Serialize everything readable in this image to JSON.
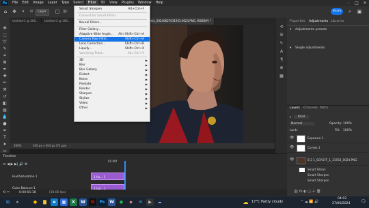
{
  "app": {
    "logo": "Ps"
  },
  "menubar": {
    "items": [
      "File",
      "Edit",
      "Image",
      "Layer",
      "Type",
      "Select",
      "Filter",
      "3D",
      "View",
      "Plugins",
      "Window",
      "Help"
    ],
    "active_index": 6
  },
  "options": {
    "layer_select": "Layer",
    "share_label": "Share"
  },
  "tabs": [
    {
      "label": "Untitled-1 @ 200..."
    },
    {
      "label": "Untitled-2 @ 100..."
    },
    {
      "label": "Untitled-3 ..."
    },
    {
      "label": "..."
    },
    {
      "label": "...1080p.WEB.h264-ELEANOR.mkv_20240627031933.0024.PNG, RGB/8#) *"
    }
  ],
  "filter_menu": {
    "items": [
      {
        "label": "Smart Sharpen",
        "shortcut": "Alt+Ctrl+F",
        "state": "normal"
      },
      {
        "sep": true
      },
      {
        "label": "Convert for Smart Filters",
        "shortcut": "",
        "state": "disabled"
      },
      {
        "sep": true
      },
      {
        "label": "Neural Filters...",
        "shortcut": "",
        "state": "normal"
      },
      {
        "sep": true
      },
      {
        "label": "Filter Gallery...",
        "shortcut": "",
        "state": "normal"
      },
      {
        "label": "Adaptive Wide Angle...",
        "shortcut": "Alt+Shift+Ctrl+A",
        "state": "normal"
      },
      {
        "label": "Camera Raw Filter...",
        "shortcut": "Shift+Ctrl+A",
        "state": "highlight"
      },
      {
        "label": "Lens Correction...",
        "shortcut": "Shift+Ctrl+R",
        "state": "normal"
      },
      {
        "label": "Liquify...",
        "shortcut": "Shift+Ctrl+X",
        "state": "normal"
      },
      {
        "label": "Vanishing Point...",
        "shortcut": "Alt+Ctrl+V",
        "state": "disabled"
      },
      {
        "sep": true
      },
      {
        "label": "3D",
        "submenu": true
      },
      {
        "label": "Blur",
        "submenu": true
      },
      {
        "label": "Blur Gallery",
        "submenu": true
      },
      {
        "label": "Distort",
        "submenu": true
      },
      {
        "label": "Noise",
        "submenu": true
      },
      {
        "label": "Pixelate",
        "submenu": true
      },
      {
        "label": "Render",
        "submenu": true
      },
      {
        "label": "Sharpen",
        "submenu": true
      },
      {
        "label": "Stylize",
        "submenu": true
      },
      {
        "label": "Video",
        "submenu": true
      },
      {
        "label": "Other",
        "submenu": true
      }
    ]
  },
  "status": {
    "zoom": "200%",
    "size": "540 px x 304 px (72 ppi)"
  },
  "panels": {
    "top_tabs": [
      "Properties",
      "Adjustments",
      "Libraries"
    ],
    "adj_presets": "Adjustments presets",
    "single_adj": "Single adjustments",
    "layer_tabs": [
      "Layers",
      "Channels",
      "Paths"
    ],
    "kind": "Kind",
    "blend": "Normal",
    "opacity_label": "Opacity:",
    "opacity": "100%",
    "lock_label": "Lock:",
    "fill_label": "Fill:",
    "fill": "100%",
    "layers": [
      {
        "name": "Exposure 1"
      },
      {
        "name": "Curves 1"
      },
      {
        "name": "B 2 1_0GYGFF_1_31933_0024.PNG"
      },
      {
        "name": "Smart Filters"
      },
      {
        "name": "Smart Sharpen"
      },
      {
        "name": "Smart Sharpen"
      }
    ]
  },
  "timeline": {
    "title": "Timeline",
    "time": "0:00:01:18",
    "fps": "(30.00 fps)",
    "marker": "01:00f",
    "tracks": [
      "Hue/Saturation 1",
      "Color Balance 1"
    ],
    "clips": [
      "1 Hu... 1",
      "1 Col... 1"
    ]
  },
  "taskbar": {
    "weather": "17°C  Partly cloudy",
    "time": "04:02",
    "date": "27/06/2024",
    "icons": [
      {
        "name": "windows-icon",
        "glyph": "⊞",
        "color": "#3aa0ff",
        "bg": "transparent"
      },
      {
        "name": "search-icon",
        "glyph": "⌕",
        "color": "#ddd",
        "bg": "transparent"
      },
      {
        "name": "chrome-icon",
        "glyph": "●",
        "color": "#fbbc05",
        "bg": "transparent"
      },
      {
        "name": "explorer-icon",
        "glyph": "▇",
        "color": "#f4c542",
        "bg": "transparent"
      },
      {
        "name": "edge-icon",
        "glyph": "e",
        "color": "#fff",
        "bg": "#0f7ac6"
      },
      {
        "name": "store-icon",
        "glyph": "▦",
        "color": "#fff",
        "bg": "#2d6ad9"
      },
      {
        "name": "excel-icon",
        "glyph": "X",
        "color": "#fff",
        "bg": "#1d7a45"
      },
      {
        "name": "word-icon",
        "glyph": "W",
        "color": "#fff",
        "bg": "#2b5797"
      },
      {
        "name": "netflix-icon",
        "glyph": "N",
        "color": "#e50914",
        "bg": "#111"
      },
      {
        "name": "photoshop-icon",
        "glyph": "Ps",
        "color": "#31a8ff",
        "bg": "#001e36"
      },
      {
        "name": "word2-icon",
        "glyph": "W",
        "color": "#fff",
        "bg": "#2b5797"
      },
      {
        "name": "spotify-icon",
        "glyph": "●",
        "color": "#1db954",
        "bg": "transparent"
      },
      {
        "name": "app-icon",
        "glyph": "◆",
        "color": "#d88",
        "bg": "transparent"
      },
      {
        "name": "mail-icon",
        "glyph": "✉",
        "color": "#4aa3ff",
        "bg": "transparent"
      },
      {
        "name": "media-icon",
        "glyph": "▶",
        "color": "#ccc",
        "bg": "#333"
      },
      {
        "name": "cloud-icon",
        "glyph": "☁",
        "color": "#7ab8ff",
        "bg": "transparent"
      }
    ]
  }
}
